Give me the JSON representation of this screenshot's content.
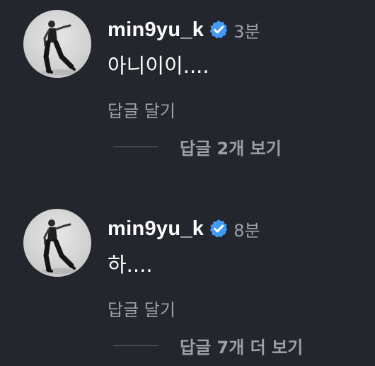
{
  "comments": [
    {
      "username": "min9yu_k",
      "time": "3분",
      "text": "아니이이....",
      "reply_label": "답글 달기",
      "view_replies_label": "답글 2개 보기"
    },
    {
      "username": "min9yu_k",
      "time": "8분",
      "text": "하....",
      "reply_label": "답글 달기",
      "view_replies_label": "답글 7개 더 보기"
    }
  ],
  "icons": {
    "verified": "verified-badge-icon",
    "avatar": "profile-photo"
  },
  "colors": {
    "background": "#24262d",
    "primary_text": "#ffffff",
    "secondary_text": "#9da0a8",
    "verified_blue": "#3f9bf5"
  }
}
